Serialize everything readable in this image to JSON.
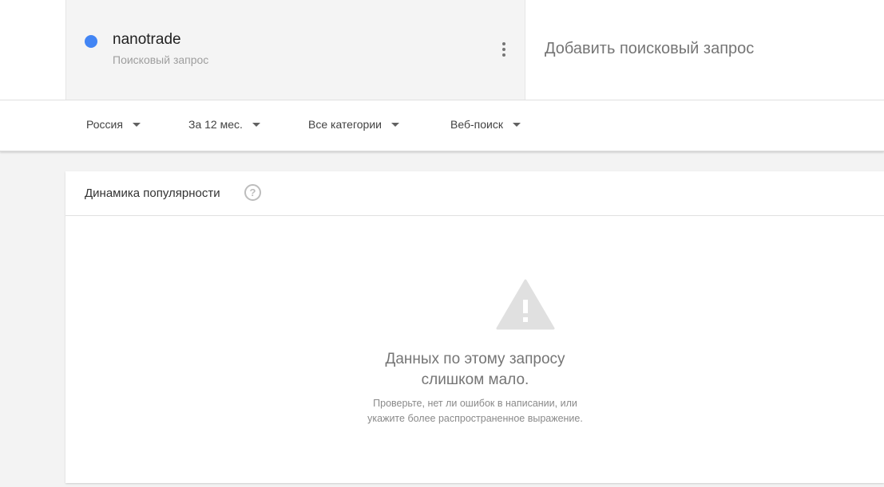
{
  "term": {
    "name": "nanotrade",
    "type": "Поисковый запрос",
    "color": "#4285f4"
  },
  "add_term": {
    "placeholder": "Добавить поисковый запрос"
  },
  "filters": {
    "region": "Россия",
    "time": "За 12 мес.",
    "category": "Все категории",
    "property": "Веб-поиск"
  },
  "interest_card": {
    "title": "Динамика популярности",
    "help_icon": "help-icon",
    "warning_icon": "warning-icon",
    "empty_title_line1": "Данных по этому запросу",
    "empty_title_line2": "слишком мало.",
    "empty_hint_line1": "Проверьте, нет ли ошибок в написании, или",
    "empty_hint_line2": "укажите более распространенное выражение."
  }
}
